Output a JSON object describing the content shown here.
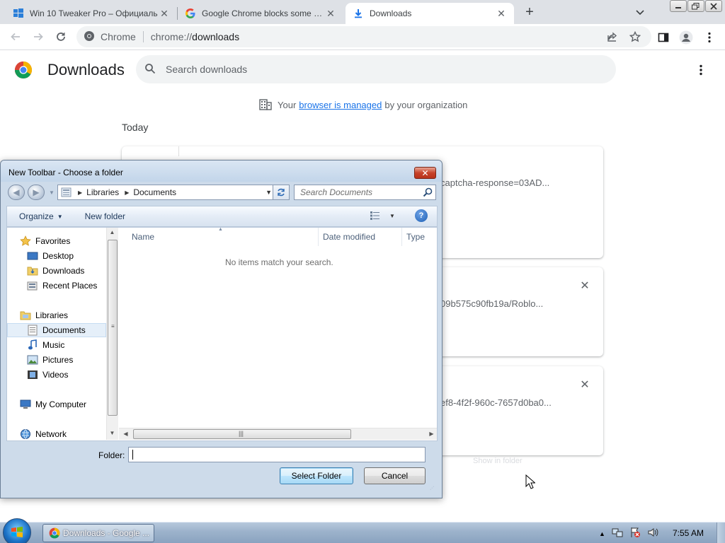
{
  "browser": {
    "tabs": [
      {
        "title": "Win 10 Tweaker Pro – Официаль",
        "icon": "windows-logo-icon"
      },
      {
        "title": "Google Chrome blocks some dov",
        "icon": "google-g-icon"
      },
      {
        "title": "Downloads",
        "icon": "download-icon"
      }
    ],
    "omnibox": {
      "site_label": "Chrome",
      "scheme": "chrome://",
      "path": "downloads"
    }
  },
  "downloads_page": {
    "title": "Downloads",
    "search_placeholder": "Search downloads",
    "managed_notice": {
      "prefix": "Your",
      "link": "browser is managed",
      "suffix": "by your organization"
    },
    "date_group": "Today",
    "items": [
      {
        "url_fragment": "captcha-response=03AD..."
      },
      {
        "url_fragment": "09b575c90fb19a/Roblo..."
      },
      {
        "url_fragment": "ef8-4f2f-960c-7657d0ba0..."
      }
    ],
    "ghost_text": "Show in folder"
  },
  "dialog": {
    "title": "New Toolbar - Choose a folder",
    "breadcrumb": [
      "Libraries",
      "Documents"
    ],
    "search_placeholder": "Search Documents",
    "commands": {
      "organize": "Organize",
      "new_folder": "New folder"
    },
    "nav": {
      "favorites": "Favorites",
      "desktop": "Desktop",
      "downloads": "Downloads",
      "recent_places": "Recent Places",
      "libraries": "Libraries",
      "documents": "Documents",
      "music": "Music",
      "pictures": "Pictures",
      "videos": "Videos",
      "my_computer": "My Computer",
      "network": "Network"
    },
    "columns": {
      "name": "Name",
      "date_modified": "Date modified",
      "type": "Type"
    },
    "empty_message": "No items match your search.",
    "folder_label": "Folder:",
    "folder_value": "",
    "select_button": "Select Folder",
    "cancel_button": "Cancel"
  },
  "taskbar": {
    "task_label": "Downloads - Google ...",
    "clock": "7:55 AM"
  },
  "colors": {
    "chrome_accent": "#1a73e8",
    "taskbar": "#9cb2cb",
    "dialog_frame": "#cddbea"
  }
}
